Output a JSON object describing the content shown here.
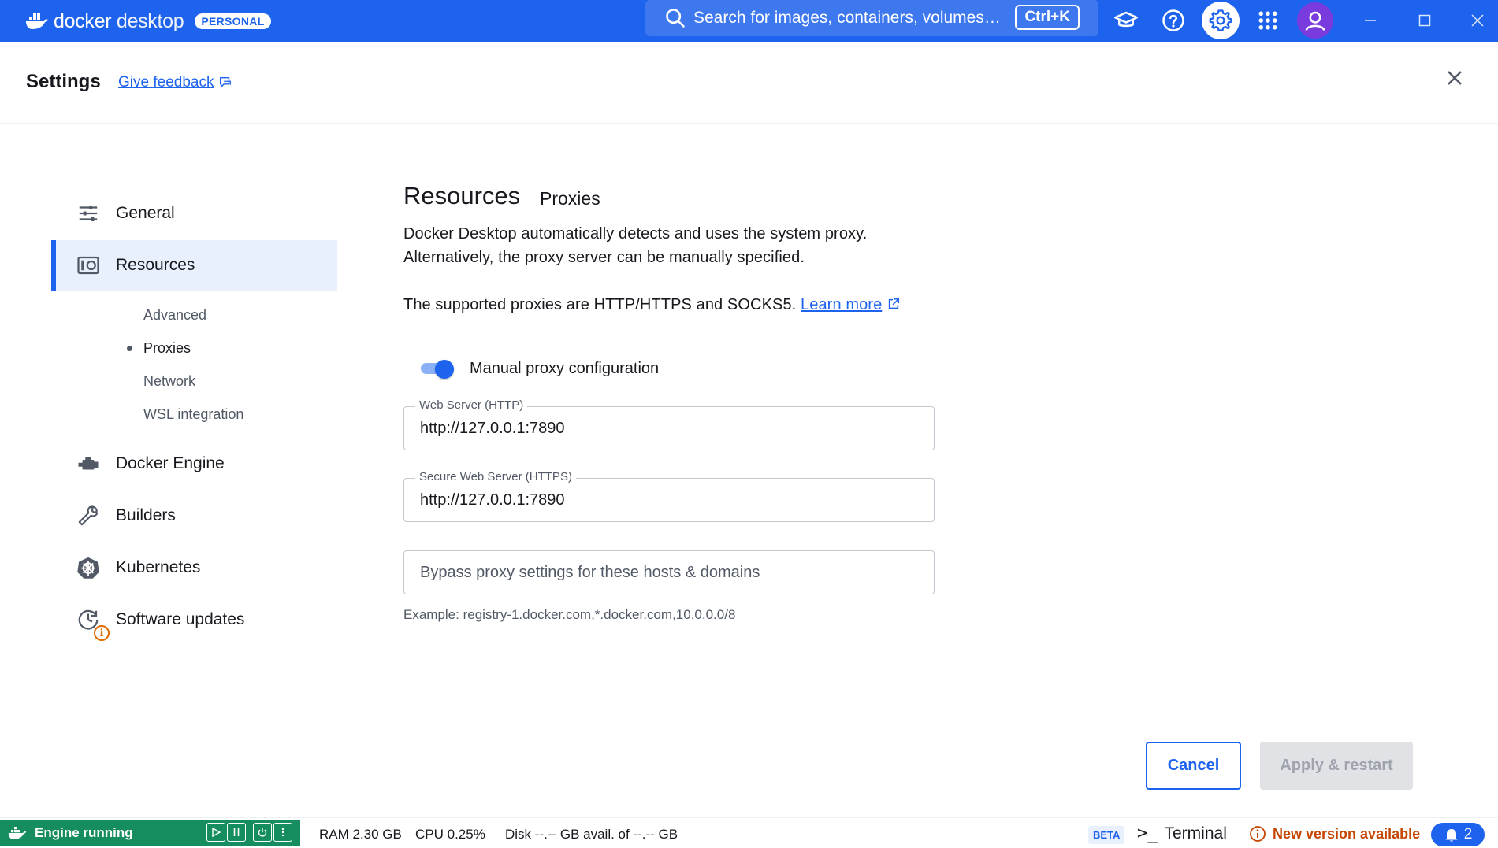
{
  "topbar": {
    "brand_strong": "docker",
    "brand_light": " desktop",
    "plan_badge": "PERSONAL",
    "search_placeholder": "Search for images, containers, volumes…",
    "search_shortcut": "Ctrl+K"
  },
  "header": {
    "title": "Settings",
    "feedback_link": "Give feedback"
  },
  "sidebar": {
    "items": [
      {
        "label": "General",
        "icon": "sliders-icon"
      },
      {
        "label": "Resources",
        "icon": "resources-icon",
        "active": true
      },
      {
        "label": "Docker Engine",
        "icon": "engine-icon"
      },
      {
        "label": "Builders",
        "icon": "wrench-icon"
      },
      {
        "label": "Kubernetes",
        "icon": "kubernetes-icon"
      },
      {
        "label": "Software updates",
        "icon": "clock-update-icon"
      }
    ],
    "subitems": [
      {
        "label": "Advanced"
      },
      {
        "label": "Proxies",
        "current": true
      },
      {
        "label": "Network"
      },
      {
        "label": "WSL integration"
      }
    ]
  },
  "content": {
    "title": "Resources",
    "subtitle": "Proxies",
    "desc_line1": "Docker Desktop automatically detects and uses the system proxy.",
    "desc_line2": "Alternatively, the proxy server can be manually specified.",
    "supported_text": "The supported proxies are HTTP/HTTPS and SOCKS5.",
    "learn_more": "Learn more",
    "toggle_label": "Manual proxy configuration",
    "toggle_on": true,
    "http_label": "Web Server (HTTP)",
    "http_value": "http://127.0.0.1:7890",
    "https_label": "Secure Web Server (HTTPS)",
    "https_value": "http://127.0.0.1:7890",
    "bypass_placeholder": "Bypass proxy settings for these hosts & domains",
    "bypass_value": "",
    "hint": "Example: registry-1.docker.com,*.docker.com,10.0.0.0/8"
  },
  "footer": {
    "cancel_label": "Cancel",
    "apply_label": "Apply & restart"
  },
  "statusbar": {
    "engine_status": "Engine running",
    "ram": "RAM 2.30 GB",
    "cpu": "CPU 0.25%",
    "disk": "Disk --.-- GB avail. of --.-- GB",
    "beta_badge": "BETA",
    "terminal_prompt": ">_",
    "terminal_label": "Terminal",
    "new_version": "New version available",
    "notification_count": "2"
  },
  "colors": {
    "brand_blue": "#1d63ed",
    "engine_green": "#168d5e",
    "warning_orange": "#c54600",
    "avatar_purple": "#7a3bde"
  }
}
